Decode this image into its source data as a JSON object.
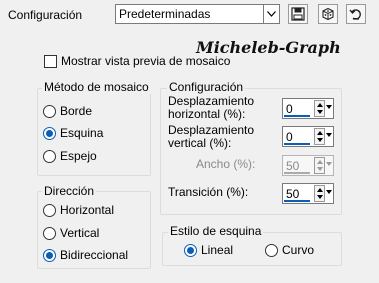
{
  "topbar": {
    "preset_label": "Configuración",
    "preset_value": "Predeterminadas",
    "save_icon": "floppy-disk-icon",
    "random_icon": "dice-icon",
    "reset_icon": "reset-icon"
  },
  "watermark": "Micheleb-Graph",
  "preview_checkbox": {
    "label": "Mostrar vista previa de mosaico",
    "checked": false
  },
  "tile_method": {
    "title": "Método de mosaico",
    "options": [
      {
        "label": "Borde",
        "checked": false
      },
      {
        "label": "Esquina",
        "checked": true
      },
      {
        "label": "Espejo",
        "checked": false
      }
    ]
  },
  "direction": {
    "title": "Dirección",
    "options": [
      {
        "label": "Horizontal",
        "checked": false
      },
      {
        "label": "Vertical",
        "checked": false
      },
      {
        "label": "Bidireccional",
        "checked": true
      }
    ]
  },
  "settings": {
    "title": "Configuración",
    "h_offset": {
      "label_line1": "Desplazamiento",
      "label_line2": "horizontal (%):",
      "value": "0"
    },
    "v_offset": {
      "label_line1": "Desplazamiento",
      "label_line2": "vertical (%):",
      "value": "0"
    },
    "width": {
      "label": "Ancho (%):",
      "value": "50",
      "disabled": true
    },
    "transition": {
      "label": "Transición (%):",
      "value": "50"
    }
  },
  "corner_style": {
    "title": "Estilo de esquina",
    "options": [
      {
        "label": "Lineal",
        "checked": true
      },
      {
        "label": "Curvo",
        "checked": false
      }
    ]
  },
  "colors": {
    "accent": "#0a5fb5",
    "background": "#f0f0f0"
  }
}
